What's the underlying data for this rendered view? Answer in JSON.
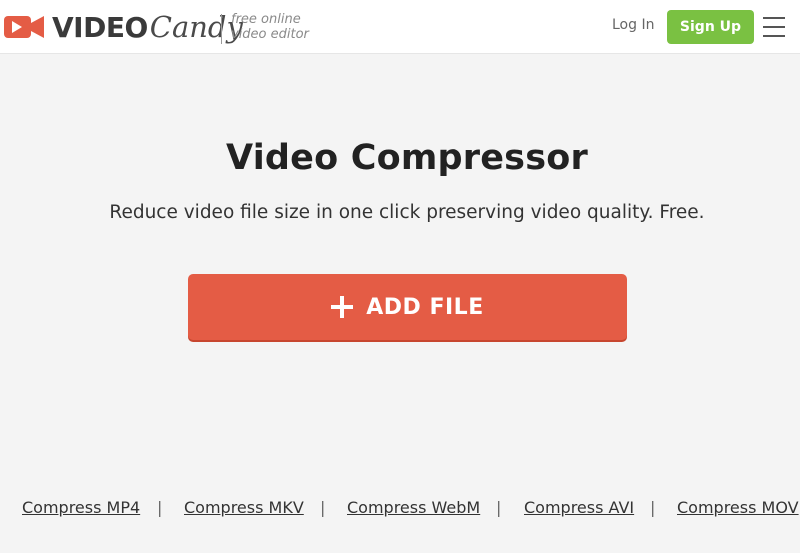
{
  "header": {
    "logo_video": "VIDEO",
    "logo_candy": "Candy",
    "tagline_line1": "free online",
    "tagline_line2": "video editor",
    "login_label": "Log In",
    "signup_label": "Sign Up",
    "menu_icon": "hamburger-menu-icon",
    "colors": {
      "brand": "#e45c45",
      "signup": "#7ac142"
    }
  },
  "main": {
    "title": "Video Compressor",
    "subtitle": "Reduce video file size in one click preserving video quality. Free.",
    "add_file_label": "ADD FILE",
    "add_file_icon": "plus-icon"
  },
  "footer": {
    "links": [
      "Compress MP4",
      "Compress MKV",
      "Compress WebM",
      "Compress AVI",
      "Compress MOV"
    ],
    "separator": "|"
  }
}
